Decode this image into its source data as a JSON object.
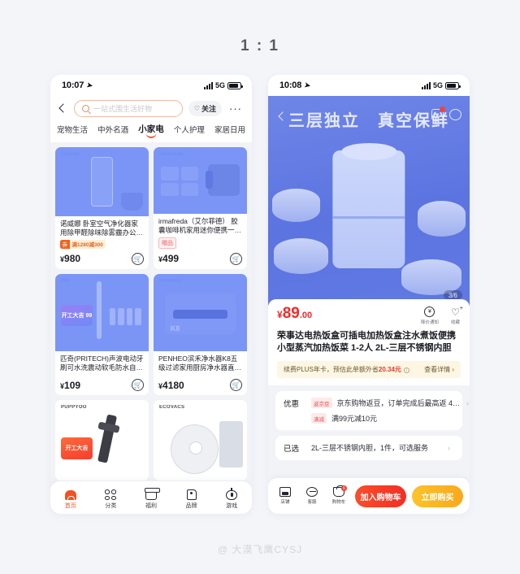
{
  "ratio_title": "1 : 1",
  "watermark": "@ 大漠飞鹰CYSJ",
  "left_phone": {
    "status": {
      "time": "10:07",
      "network": "5G"
    },
    "search": {
      "placeholder": "一站式围生活好物",
      "follow_label": "关注",
      "more": "···"
    },
    "tabs": [
      {
        "label": "宠物生活",
        "active": false
      },
      {
        "label": "中外名酒",
        "active": false
      },
      {
        "label": "小家电",
        "active": true
      },
      {
        "label": "个人护理",
        "active": false
      },
      {
        "label": "家居日用",
        "active": false
      }
    ],
    "products": [
      {
        "title": "诺威娜 卧室空气净化器家用除甲醛除味除雾霾办公…",
        "badge_type": "coupon",
        "badge_left": "券",
        "badge_right": "满1280减300",
        "price": "980",
        "currency": "¥",
        "brand": "novena"
      },
      {
        "title": "irmafreda（艾尔菲德） 胶囊咖啡机家用迷你便携一…",
        "badge_type": "gift",
        "badge_left": "赠品",
        "badge_right": "",
        "price": "499",
        "currency": "¥",
        "brand": "irmafreda"
      },
      {
        "title": "匹奇(PRITECH)声波电动牙刷可水洗震动软毛防水自…",
        "badge_type": "none",
        "badge_left": "",
        "badge_right": "",
        "price": "109",
        "currency": "¥",
        "brand": "PRI",
        "promo": "开工大吉 99"
      },
      {
        "title": "PENHEO滨禾净水器K8五级过滤家用厨房净水器直…",
        "badge_type": "none",
        "badge_left": "",
        "badge_right": "",
        "price": "4180",
        "currency": "¥",
        "brand": "PENHEO"
      },
      {
        "title": "",
        "badge_type": "none",
        "badge_left": "",
        "badge_right": "",
        "price": "",
        "currency": "",
        "brand": "PUPPYOO",
        "promo": "开工大吉"
      },
      {
        "title": "",
        "badge_type": "none",
        "badge_left": "",
        "badge_right": "",
        "price": "",
        "currency": "",
        "brand": "ECOVACS"
      }
    ],
    "nav": [
      {
        "label": "首页",
        "icon": "home-icon",
        "active": true
      },
      {
        "label": "分类",
        "icon": "category-icon",
        "active": false
      },
      {
        "label": "福利",
        "icon": "gift-icon",
        "active": false
      },
      {
        "label": "品牌",
        "icon": "brand-icon",
        "active": false
      },
      {
        "label": "游戏",
        "icon": "game-icon",
        "active": false
      }
    ]
  },
  "right_phone": {
    "status": {
      "time": "10:08",
      "network": "5G"
    },
    "hero": {
      "headline": "三层独立　真空保鲜",
      "pager": "3/6"
    },
    "price": {
      "currency": "¥",
      "integer": "89",
      "decimal": ".00"
    },
    "price_actions": [
      {
        "label": "降价通知",
        "icon": "bell-icon"
      },
      {
        "label": "收藏",
        "icon": "favorite-icon"
      }
    ],
    "product_title": "荣事达电热饭盒可插电加热饭盒注水煮饭便携小型蒸汽加热饭菜 1-2人 2L-三层不锈钢内胆",
    "plus_banner": {
      "text_before": "续费PLUS年卡，预估此单额外省",
      "highlight": "20.34元",
      "detail_label": "查看详情 ›"
    },
    "promo_block": {
      "label": "优惠",
      "lines": [
        {
          "tag": "返京豆",
          "text": "京东购物返豆，订单完成后最高返 4…"
        },
        {
          "tag": "满减",
          "text": "满99元减10元"
        }
      ]
    },
    "selected_block": {
      "label": "已选",
      "text": "2L-三层不锈钢内胆，1件，可选服务"
    },
    "bottom": {
      "icons": [
        {
          "label": "店铺",
          "icon": "shop-icon",
          "badge": ""
        },
        {
          "label": "客服",
          "icon": "service-icon",
          "badge": ""
        },
        {
          "label": "购物车",
          "icon": "cart-icon",
          "badge": "6"
        }
      ],
      "add_cart_label": "加入购物车",
      "buy_now_label": "立即购买"
    }
  },
  "colors": {
    "background": "#f4f5f9",
    "accent_orange": "#f4511e",
    "price_red": "#f22a2a",
    "buy_yellow": "#f9a81c",
    "hero_blue": "#5b74e0"
  }
}
